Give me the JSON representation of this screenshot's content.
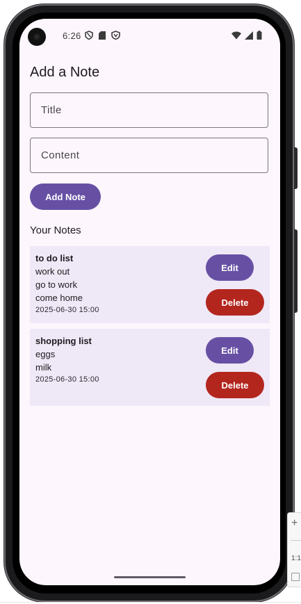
{
  "status_bar": {
    "time": "6:26",
    "left_icons": [
      "shield-icon",
      "sd-card-icon",
      "vpn-shield-icon"
    ],
    "right_icons": [
      "wifi-icon",
      "signal-icon",
      "battery-icon"
    ]
  },
  "page": {
    "title": "Add a Note"
  },
  "form": {
    "title_placeholder": "Title",
    "title_value": "",
    "content_placeholder": "Content",
    "content_value": "",
    "add_button_label": "Add Note"
  },
  "notes_section": {
    "heading": "Your Notes",
    "notes": [
      {
        "title": "to do list",
        "lines": [
          "work out",
          "go to work",
          "come home"
        ],
        "timestamp": "2025-06-30 15:00",
        "edit_label": "Edit",
        "delete_label": "Delete"
      },
      {
        "title": "shopping list",
        "lines": [
          "eggs",
          "milk"
        ],
        "timestamp": "2025-06-30 15:00",
        "edit_label": "Edit",
        "delete_label": "Delete"
      }
    ]
  },
  "emulator_toolbar": {
    "zoom_in": "+",
    "ratio_label": "1:1"
  },
  "colors": {
    "primary": "#6750a4",
    "danger": "#b3261e",
    "surface": "#fdf6fc",
    "card": "#efe8f6"
  }
}
